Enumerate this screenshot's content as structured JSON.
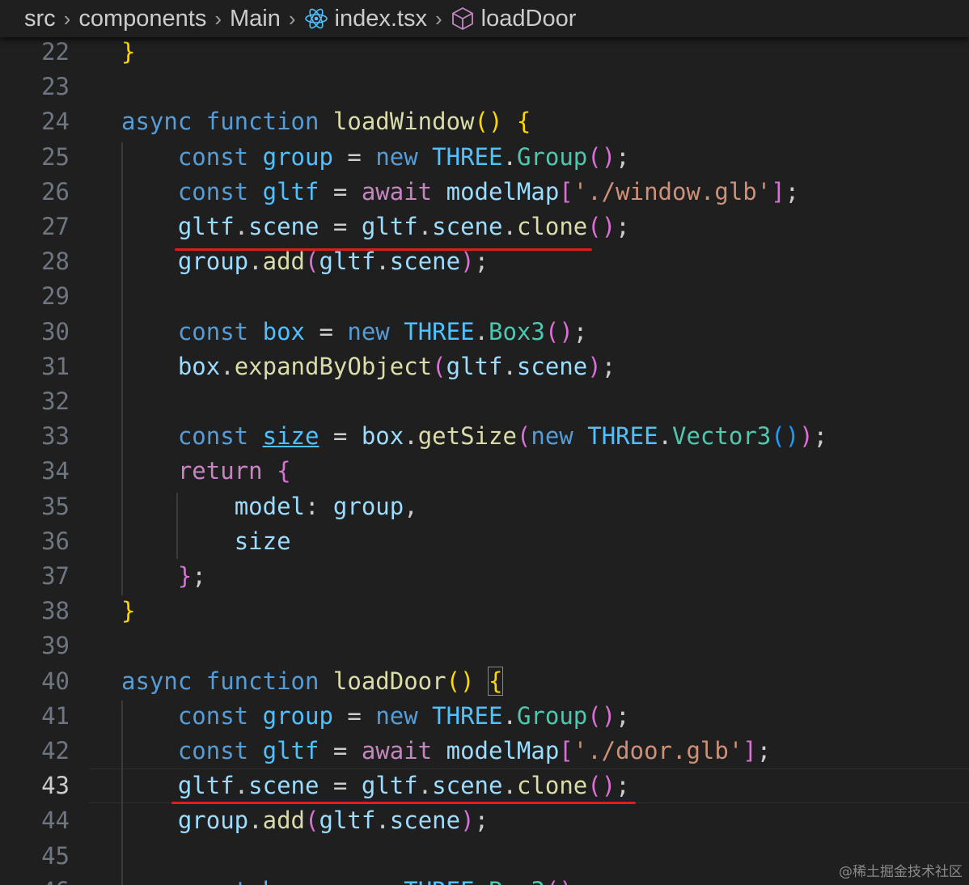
{
  "breadcrumb": {
    "items": [
      "src",
      "components",
      "Main",
      "index.tsx",
      "loadDoor"
    ],
    "icons": {
      "file": "react-icon",
      "symbol": "cube-icon"
    }
  },
  "editor": {
    "active_line": "43",
    "line_numbers": [
      "22",
      "23",
      "24",
      "25",
      "26",
      "27",
      "28",
      "29",
      "30",
      "31",
      "32",
      "33",
      "34",
      "35",
      "36",
      "37",
      "38",
      "39",
      "40",
      "41",
      "42",
      "43",
      "44",
      "45",
      "46"
    ]
  },
  "colors": {
    "background": "#1f1f1f",
    "keyword": "#569cd6",
    "control": "#c586c0",
    "function": "#dcdcaa",
    "variable": "#9cdcfe",
    "class": "#4ec9b0",
    "constant": "#4fc1ff",
    "string": "#ce9178",
    "annotation_underline": "#e01b1b"
  },
  "watermark": "@稀土掘金技术社区"
}
